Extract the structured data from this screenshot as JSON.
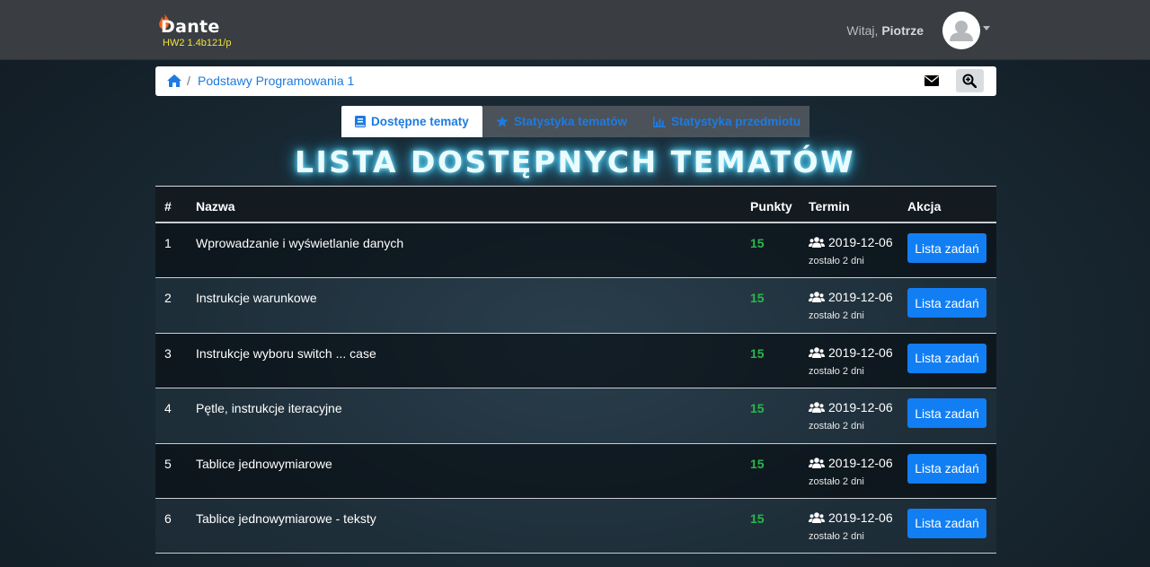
{
  "brand": {
    "name": "Dante",
    "version": "HW2 1.4b121/p"
  },
  "user": {
    "greeting": "Witaj,",
    "name": "Piotrze"
  },
  "breadcrumb": {
    "separator": "/",
    "course": "Podstawy Programowania 1"
  },
  "tabs": [
    {
      "label": "Dostępne tematy",
      "active": true
    },
    {
      "label": "Statystyka tematów",
      "active": false
    },
    {
      "label": "Statystyka przedmiotu",
      "active": false
    }
  ],
  "page_title": "LISTA DOSTĘPNYCH TEMATÓW",
  "table": {
    "headers": {
      "num": "#",
      "name": "Nazwa",
      "points": "Punkty",
      "deadline": "Termin",
      "action": "Akcja"
    },
    "rows": [
      {
        "num": "1",
        "name": "Wprowadzanie i wyświetlanie danych",
        "points": "15",
        "date": "2019-12-06",
        "left": "zostało 2 dni",
        "button": "Lista zadań"
      },
      {
        "num": "2",
        "name": "Instrukcje warunkowe",
        "points": "15",
        "date": "2019-12-06",
        "left": "zostało 2 dni",
        "button": "Lista zadań"
      },
      {
        "num": "3",
        "name": "Instrukcje wyboru switch ... case",
        "points": "15",
        "date": "2019-12-06",
        "left": "zostało 2 dni",
        "button": "Lista zadań"
      },
      {
        "num": "4",
        "name": "Pętle, instrukcje iteracyjne",
        "points": "15",
        "date": "2019-12-06",
        "left": "zostało 2 dni",
        "button": "Lista zadań"
      },
      {
        "num": "5",
        "name": "Tablice jednowymiarowe",
        "points": "15",
        "date": "2019-12-06",
        "left": "zostało 2 dni",
        "button": "Lista zadań"
      },
      {
        "num": "6",
        "name": "Tablice jednowymiarowe - teksty",
        "points": "15",
        "date": "2019-12-06",
        "left": "zostało 2 dni",
        "button": "Lista zadań"
      }
    ]
  },
  "colors": {
    "accent": "#1e7be0",
    "button": "#127ef4",
    "points": "#29b84a",
    "version": "#f1e33a",
    "navbar": "#3a3d42"
  },
  "icons": [
    "flame-icon",
    "user-avatar-icon",
    "home-icon",
    "mail-icon",
    "zoom-in-icon",
    "book-icon",
    "star-icon",
    "bar-chart-icon",
    "users-icon"
  ]
}
